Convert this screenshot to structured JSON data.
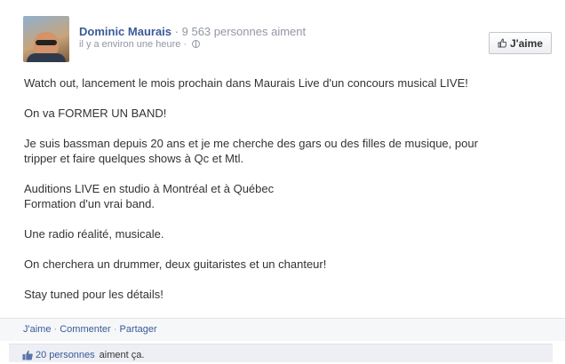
{
  "post": {
    "author": "Dominic Maurais",
    "separator": "·",
    "page_likes": "9 563 personnes aiment",
    "timestamp": "il y a environ une heure ·",
    "like_page_label": "J'aime",
    "paragraphs": [
      "Watch out, lancement le mois prochain dans Maurais Live d'un concours musical LIVE!",
      "On va FORMER UN BAND!",
      "Je suis bassman depuis 20 ans et je me cherche des gars ou des filles de musique, pour",
      "tripper et faire quelques shows à Qc et Mtl.",
      "Auditions LIVE en studio à Montréal et à Québec",
      "Formation d'un vrai band.",
      "Une radio réalité, musicale.",
      "On cherchera un drummer, deux guitaristes et un chanteur!",
      "Stay tuned pour les détails!"
    ]
  },
  "actions": {
    "like": "J'aime",
    "sep": " · ",
    "comment": "Commenter",
    "share": "Partager"
  },
  "likes_summary": {
    "count_link": "20 personnes",
    "text": "aiment ça."
  },
  "colors": {
    "link": "#3b5998",
    "muted": "#9197a3",
    "action_bar_bg": "#f6f7f9",
    "likes_bg": "#edeff4"
  }
}
